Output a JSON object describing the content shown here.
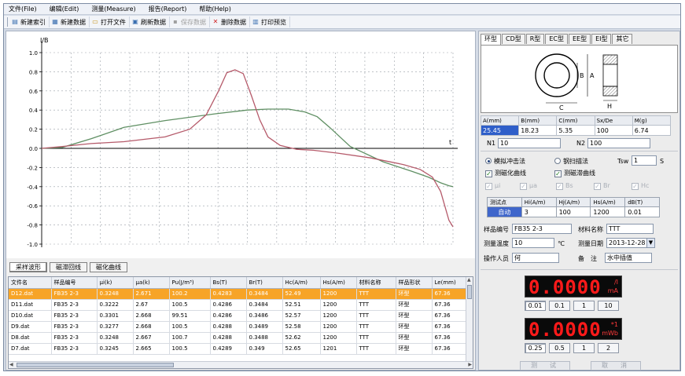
{
  "menu": [
    "文件(File)",
    "编辑(Edit)",
    "测量(Measure)",
    "报告(Report)",
    "帮助(Help)"
  ],
  "toolbar": [
    {
      "label": "新建索引",
      "icon": "new-index-icon",
      "glyph": "▤",
      "enabled": true
    },
    {
      "label": "新建数据",
      "icon": "new-data-icon",
      "glyph": "▦",
      "enabled": true
    },
    {
      "label": "打开文件",
      "icon": "open-folder-icon",
      "glyph": "▭",
      "enabled": true
    },
    {
      "label": "刷新数据",
      "icon": "refresh-icon",
      "glyph": "▣",
      "enabled": true
    },
    {
      "label": "保存数据",
      "icon": "save-icon",
      "glyph": "▪",
      "enabled": false
    },
    {
      "label": "删除数据",
      "icon": "delete-icon",
      "glyph": "✕",
      "enabled": true
    },
    {
      "label": "打印预览",
      "icon": "print-preview-icon",
      "glyph": "▥",
      "enabled": true
    }
  ],
  "chart_data": {
    "type": "line",
    "ylabel": "I/B",
    "xlabel": "t",
    "ylim": [
      -1.0,
      1.0
    ],
    "yticks": [
      "1.0",
      "0.8",
      "0.6",
      "0.4",
      "0.2",
      "0.0",
      "-0.2",
      "-0.4",
      "-0.6",
      "-0.8",
      "-1.0"
    ],
    "grid": true,
    "series": [
      {
        "color": "#5f8f63",
        "x": [
          0,
          0.05,
          0.12,
          0.2,
          0.3,
          0.42,
          0.5,
          0.55,
          0.6,
          0.64,
          0.67,
          0.7,
          0.75,
          0.83,
          0.9,
          0.94,
          0.97,
          0.99,
          1.0
        ],
        "y": [
          0,
          0.01,
          0.1,
          0.22,
          0.29,
          0.36,
          0.4,
          0.41,
          0.41,
          0.38,
          0.33,
          0.22,
          0.02,
          -0.14,
          -0.24,
          -0.3,
          -0.36,
          -0.39,
          -0.4
        ]
      },
      {
        "color": "#b55a6a",
        "x": [
          0,
          0.05,
          0.12,
          0.2,
          0.3,
          0.36,
          0.4,
          0.43,
          0.45,
          0.47,
          0.49,
          0.51,
          0.53,
          0.55,
          0.58,
          0.62,
          0.66,
          0.72,
          0.8,
          0.88,
          0.92,
          0.95,
          0.97,
          0.99,
          1.0
        ],
        "y": [
          0,
          0.02,
          0.05,
          0.07,
          0.12,
          0.2,
          0.35,
          0.6,
          0.79,
          0.82,
          0.78,
          0.55,
          0.3,
          0.12,
          0.03,
          -0.01,
          -0.02,
          -0.05,
          -0.1,
          -0.17,
          -0.22,
          -0.3,
          -0.45,
          -0.75,
          -0.82
        ]
      }
    ]
  },
  "view_tabs": [
    "采样波形",
    "磁滞回线",
    "磁化曲线"
  ],
  "table": {
    "columns": [
      "文件名",
      "样品编号",
      "μi(k)",
      "μa(k)",
      "Pu(J/m³)",
      "Bs(T)",
      "Br(T)",
      "Hc(A/m)",
      "Hs(A/m)",
      "材料名称",
      "样品形状",
      "Le(mm)"
    ],
    "rows": [
      [
        "D12.dat",
        "FB35 2-3",
        "0.3248",
        "2.671",
        "100.2",
        "0.4283",
        "0.3484",
        "52.49",
        "1200",
        "TTT",
        "环型",
        "67.36"
      ],
      [
        "D11.dat",
        "FB35 2-3",
        "0.3222",
        "2.67",
        "100.5",
        "0.4286",
        "0.3484",
        "52.51",
        "1200",
        "TTT",
        "环型",
        "67.36"
      ],
      [
        "D10.dat",
        "FB35 2-3",
        "0.3301",
        "2.668",
        "99.51",
        "0.4286",
        "0.3486",
        "52.57",
        "1200",
        "TTT",
        "环型",
        "67.36"
      ],
      [
        "D9.dat",
        "FB35 2-3",
        "0.3277",
        "2.668",
        "100.5",
        "0.4288",
        "0.3489",
        "52.58",
        "1200",
        "TTT",
        "环型",
        "67.36"
      ],
      [
        "D8.dat",
        "FB35 2-3",
        "0.3248",
        "2.667",
        "100.7",
        "0.4288",
        "0.3488",
        "52.62",
        "1200",
        "TTT",
        "环型",
        "67.36"
      ],
      [
        "D7.dat",
        "FB35 2-3",
        "0.3245",
        "2.665",
        "100.5",
        "0.4289",
        "0.349",
        "52.65",
        "1201",
        "TTT",
        "环型",
        "67.36"
      ]
    ],
    "selected_row": 0
  },
  "shape_tabs": [
    "环型",
    "CD型",
    "R型",
    "EC型",
    "EE型",
    "EI型",
    "其它"
  ],
  "shape_labels": {
    "b": "B",
    "a": "A",
    "c": "C",
    "h": "H"
  },
  "dimensions": {
    "columns": [
      "A(mm)",
      "B(mm)",
      "C(mm)",
      "Sx/De",
      "M(g)"
    ],
    "values": [
      "25.45",
      "18.23",
      "5.35",
      "100",
      "6.74"
    ]
  },
  "coils": {
    "n1_label": "N1",
    "n1": "10",
    "n2_label": "N2",
    "n2": "100"
  },
  "method": {
    "impulse": "模拟冲击法",
    "scan": "钢扫描法",
    "tsw_label": "Tsw",
    "tsw": "1",
    "tsw_unit": "S"
  },
  "curves": {
    "magnetization": "测磁化曲线",
    "hysteresis": "测磁滞曲线"
  },
  "disabled_options": [
    "μi",
    "μa",
    "Bs",
    "Br",
    "Hc"
  ],
  "measure": {
    "columns": [
      "测试点",
      "Hi(A/m)",
      "Hj(A/m)",
      "Hs(A/m)",
      "dB(T)"
    ],
    "values": [
      "自动",
      "3",
      "100",
      "1200",
      "0.01"
    ]
  },
  "sample": {
    "id_label": "样品编号",
    "id": "FB35 2-3",
    "material_label": "材料名称",
    "material": "TTT",
    "temp_label": "测量温度",
    "temp": "10",
    "temp_unit": "℃",
    "date_label": "测量日期",
    "date": "2013-12-28",
    "operator_label": "操作人员",
    "operator": "何",
    "note_label": "备　注",
    "note": "水中插值"
  },
  "meter1": {
    "value": "0.0000",
    "unit_top": "/I",
    "unit_bottom": "mA",
    "ranges": [
      "0.01",
      "0.1",
      "1",
      "10"
    ],
    "active_range": 0
  },
  "meter2": {
    "value": "0.0000",
    "unit_top": "*1",
    "unit_bottom": "mWb",
    "ranges": [
      "0.25",
      "0.5",
      "1",
      "2"
    ],
    "active_range": 0
  },
  "actions": {
    "test": "测　试",
    "cancel": "取　消"
  }
}
